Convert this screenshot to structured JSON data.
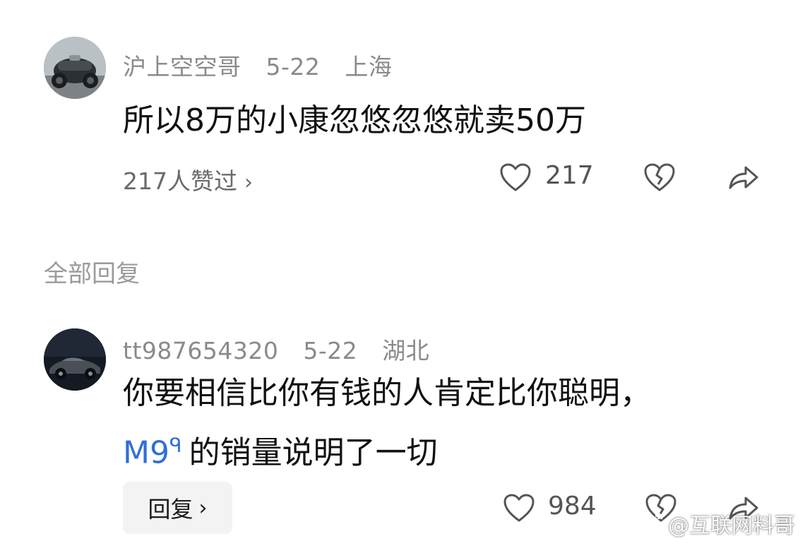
{
  "comment": {
    "username": "沪上空空哥",
    "date": "5-22",
    "location": "上海",
    "text": "所以8万的小康忽悠忽悠就卖50万",
    "likes_summary": "217人赞过",
    "like_count": "217",
    "icons": {
      "avatar": "motorcycle-avatar",
      "like": "heart-icon",
      "dislike": "broken-heart-icon",
      "share": "share-arrow-icon",
      "chevron": "chevron-right-icon"
    }
  },
  "section": {
    "title": "全部回复"
  },
  "reply": {
    "username": "tt987654320",
    "date": "5-22",
    "location": "湖北",
    "text_line1": "你要相信比你有钱的人肯定比你聪明，",
    "mention": "M9",
    "text_line2": "的销量说明了一切",
    "reply_button": "回复",
    "like_count": "984",
    "icons": {
      "avatar": "car-avatar",
      "mention": "search-icon",
      "like": "heart-icon",
      "dislike": "broken-heart-icon",
      "share": "share-arrow-icon"
    }
  },
  "watermark": {
    "text": "@互联网料哥",
    "icon": "weibo-icon"
  },
  "colors": {
    "meta": "#8a8a8a",
    "mention": "#2f6fd6",
    "reply_button_bg": "#f3f3f3"
  }
}
